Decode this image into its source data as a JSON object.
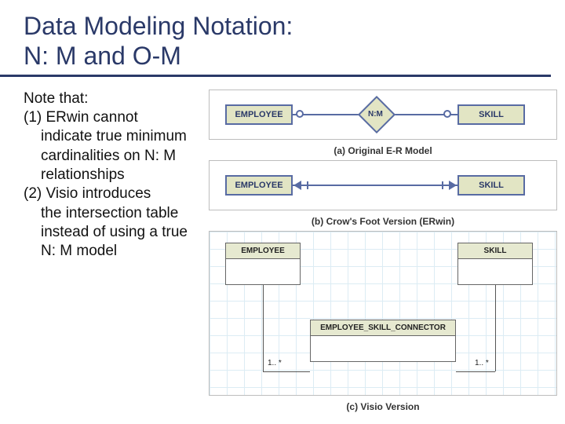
{
  "title": {
    "line1": "Data Modeling Notation:",
    "line2": "N: M and O-M"
  },
  "notes": {
    "intro": "Note that:",
    "item1_num": "(1) ",
    "item1_head": "ERwin cannot",
    "item1_rest": "indicate true minimum cardinalities on N: M relationships",
    "item2_num": "(2) ",
    "item2_head": "Visio introduces",
    "item2_rest": "the intersection table instead of using a true N: M model"
  },
  "diagram": {
    "employee": "EMPLOYEE",
    "skill": "SKILL",
    "nm": "N:M",
    "connector": "EMPLOYEE_SKILL_CONNECTOR",
    "cap_a": "(a) Original E-R Model",
    "cap_b": "(b) Crow's Foot Version (ERwin)",
    "cap_c": "(c) Visio Version",
    "mult": "1.. *"
  }
}
